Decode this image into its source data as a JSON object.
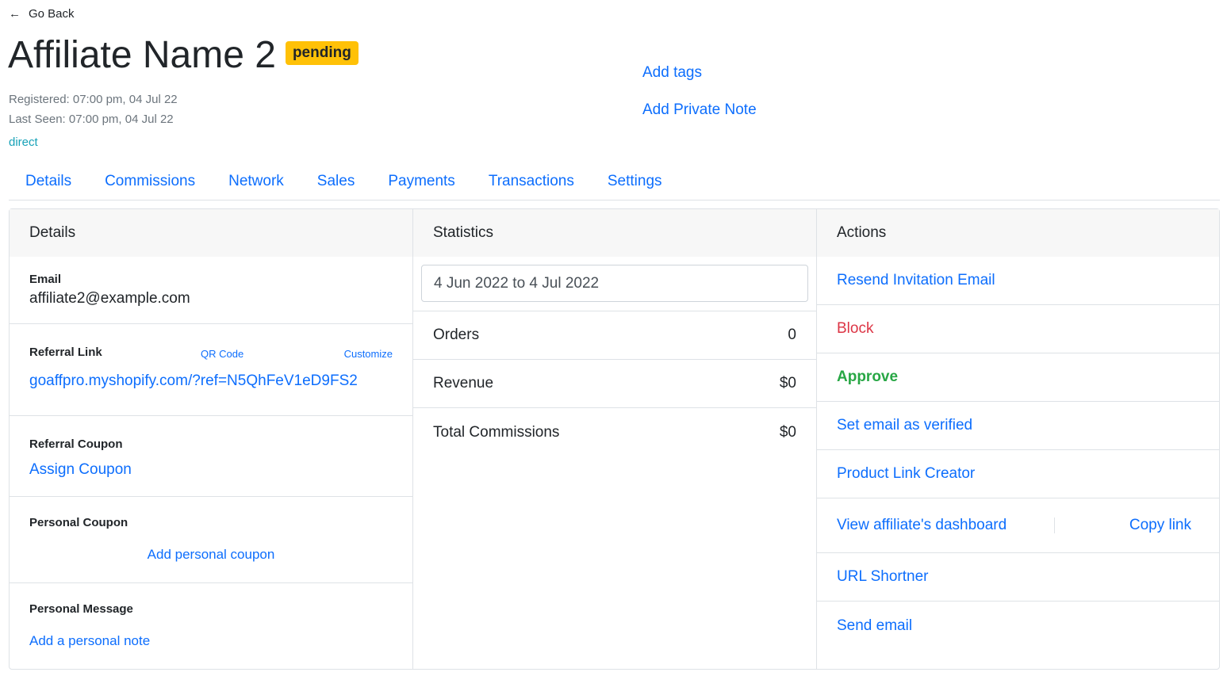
{
  "header": {
    "go_back": "Go Back",
    "name": "Affiliate Name 2",
    "status": "pending",
    "registered": "Registered: 07:00 pm, 04 Jul 22",
    "last_seen": "Last Seen: 07:00 pm, 04 Jul 22",
    "source": "direct",
    "add_tags": "Add tags",
    "add_private_note": "Add Private Note"
  },
  "tabs": [
    "Details",
    "Commissions",
    "Network",
    "Sales",
    "Payments",
    "Transactions",
    "Settings"
  ],
  "details": {
    "title": "Details",
    "email_label": "Email",
    "email": "affiliate2@example.com",
    "referral_link_label": "Referral Link",
    "qr_code": "QR Code",
    "customize": "Customize",
    "referral_link": "goaffpro.myshopify.com/?ref=N5QhFeV1eD9FS2",
    "referral_coupon_label": "Referral Coupon",
    "assign_coupon": "Assign Coupon",
    "personal_coupon_label": "Personal Coupon",
    "add_personal_coupon": "Add personal coupon",
    "personal_message_label": "Personal Message",
    "add_personal_note": "Add a personal note"
  },
  "statistics": {
    "title": "Statistics",
    "date_range": "4 Jun 2022 to 4 Jul 2022",
    "rows": [
      {
        "label": "Orders",
        "value": "0"
      },
      {
        "label": "Revenue",
        "value": "$0"
      },
      {
        "label": "Total Commissions",
        "value": "$0"
      }
    ]
  },
  "actions": {
    "title": "Actions",
    "resend_invitation": "Resend Invitation Email",
    "block": "Block",
    "approve": "Approve",
    "set_email_verified": "Set email as verified",
    "product_link_creator": "Product Link Creator",
    "view_dashboard": "View affiliate's dashboard",
    "copy_link": "Copy link",
    "url_shortner": "URL Shortner",
    "send_email": "Send email"
  },
  "colors": {
    "link": "#0d6efd",
    "badge": "#ffc107",
    "danger": "#dc3545",
    "success": "#28a745",
    "muted": "#6c757d",
    "info": "#17a2b8"
  }
}
